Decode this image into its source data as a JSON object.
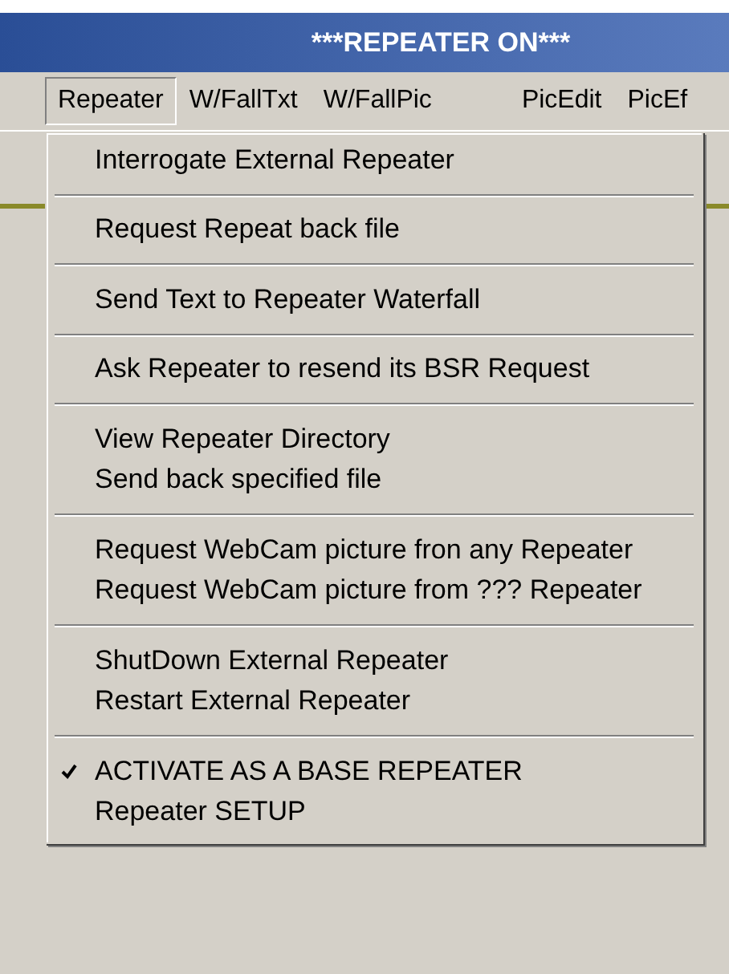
{
  "window": {
    "title": "***REPEATER ON***"
  },
  "menu_bar": [
    {
      "label": "Repeater",
      "selected": true
    },
    {
      "label": "W/FallTxt",
      "selected": false
    },
    {
      "label": "W/FallPic",
      "selected": false
    },
    {
      "label": "PicEdit",
      "selected": false
    },
    {
      "label": "PicEf",
      "selected": false
    }
  ],
  "menu": {
    "groups": [
      [
        {
          "label": "Interrogate External Repeater",
          "checked": false
        }
      ],
      [
        {
          "label": "Request Repeat back file",
          "checked": false
        }
      ],
      [
        {
          "label": "Send Text to Repeater Waterfall",
          "checked": false
        }
      ],
      [
        {
          "label": "Ask Repeater to resend its BSR Request",
          "checked": false
        }
      ],
      [
        {
          "label": "View Repeater Directory",
          "checked": false
        },
        {
          "label": "Send back specified file",
          "checked": false
        }
      ],
      [
        {
          "label": "Request WebCam picture fron any Repeater",
          "checked": false
        },
        {
          "label": "Request WebCam picture from ??? Repeater",
          "checked": false
        }
      ],
      [
        {
          "label": "ShutDown External Repeater",
          "checked": false
        },
        {
          "label": "Restart External Repeater",
          "checked": false
        }
      ],
      [
        {
          "label": "ACTIVATE AS A BASE REPEATER",
          "checked": true
        },
        {
          "label": "Repeater SETUP",
          "checked": false
        }
      ]
    ]
  }
}
